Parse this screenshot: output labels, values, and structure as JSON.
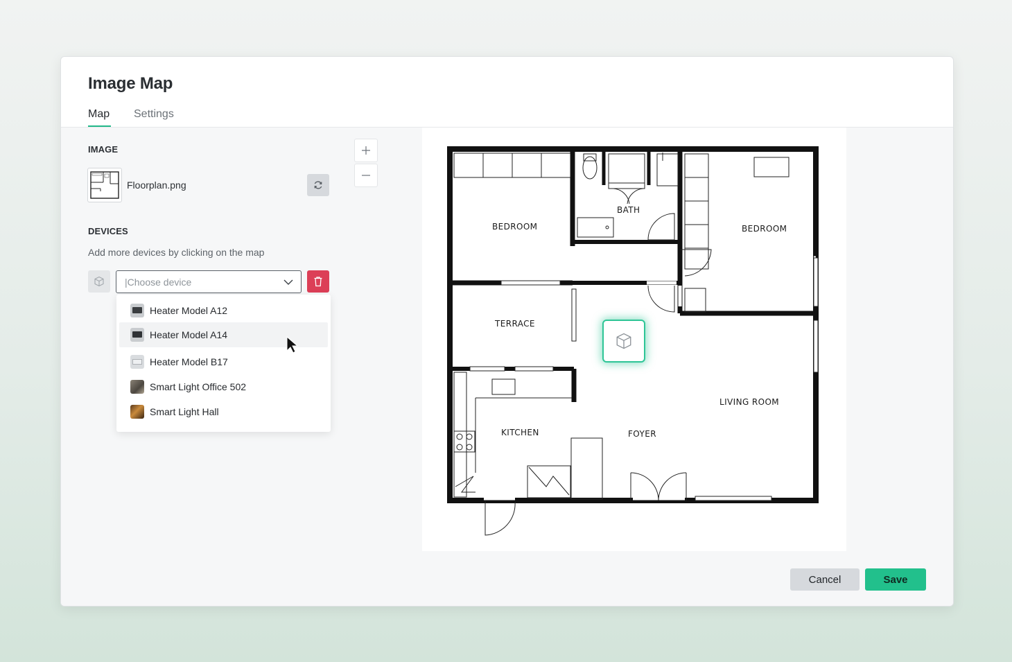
{
  "dialog": {
    "title": "Image Map",
    "tabs": [
      {
        "label": "Map",
        "active": true
      },
      {
        "label": "Settings",
        "active": false
      }
    ]
  },
  "image_section": {
    "label": "IMAGE",
    "filename": "Floorplan.png",
    "refresh_icon": "refresh-icon"
  },
  "devices_section": {
    "label": "DEVICES",
    "hint": "Add more devices by clicking on the map",
    "device_icon": "cube-icon",
    "select": {
      "placeholder": "|Choose device",
      "chevron_icon": "chevron-down-icon"
    },
    "delete_icon": "trash-icon",
    "options": [
      {
        "label": "Heater Model A12",
        "hovered": false
      },
      {
        "label": "Heater Model A14",
        "hovered": true
      },
      {
        "label": "Heater Model B17",
        "hovered": false
      },
      {
        "label": "Smart Light Office 502",
        "hovered": false
      },
      {
        "label": "Smart Light Hall",
        "hovered": false
      }
    ]
  },
  "zoom": {
    "in_icon": "plus-icon",
    "out_icon": "minus-icon"
  },
  "floorplan": {
    "rooms": [
      "BEDROOM",
      "BATH",
      "BEDROOM",
      "TERRACE",
      "LIVING ROOM",
      "KITCHEN",
      "FOYER"
    ],
    "marker_icon": "cube-icon"
  },
  "footer": {
    "cancel_label": "Cancel",
    "save_label": "Save"
  },
  "colors": {
    "accent": "#22c08c",
    "danger": "#dc3f57",
    "neutral_button": "#d6d9dd"
  }
}
